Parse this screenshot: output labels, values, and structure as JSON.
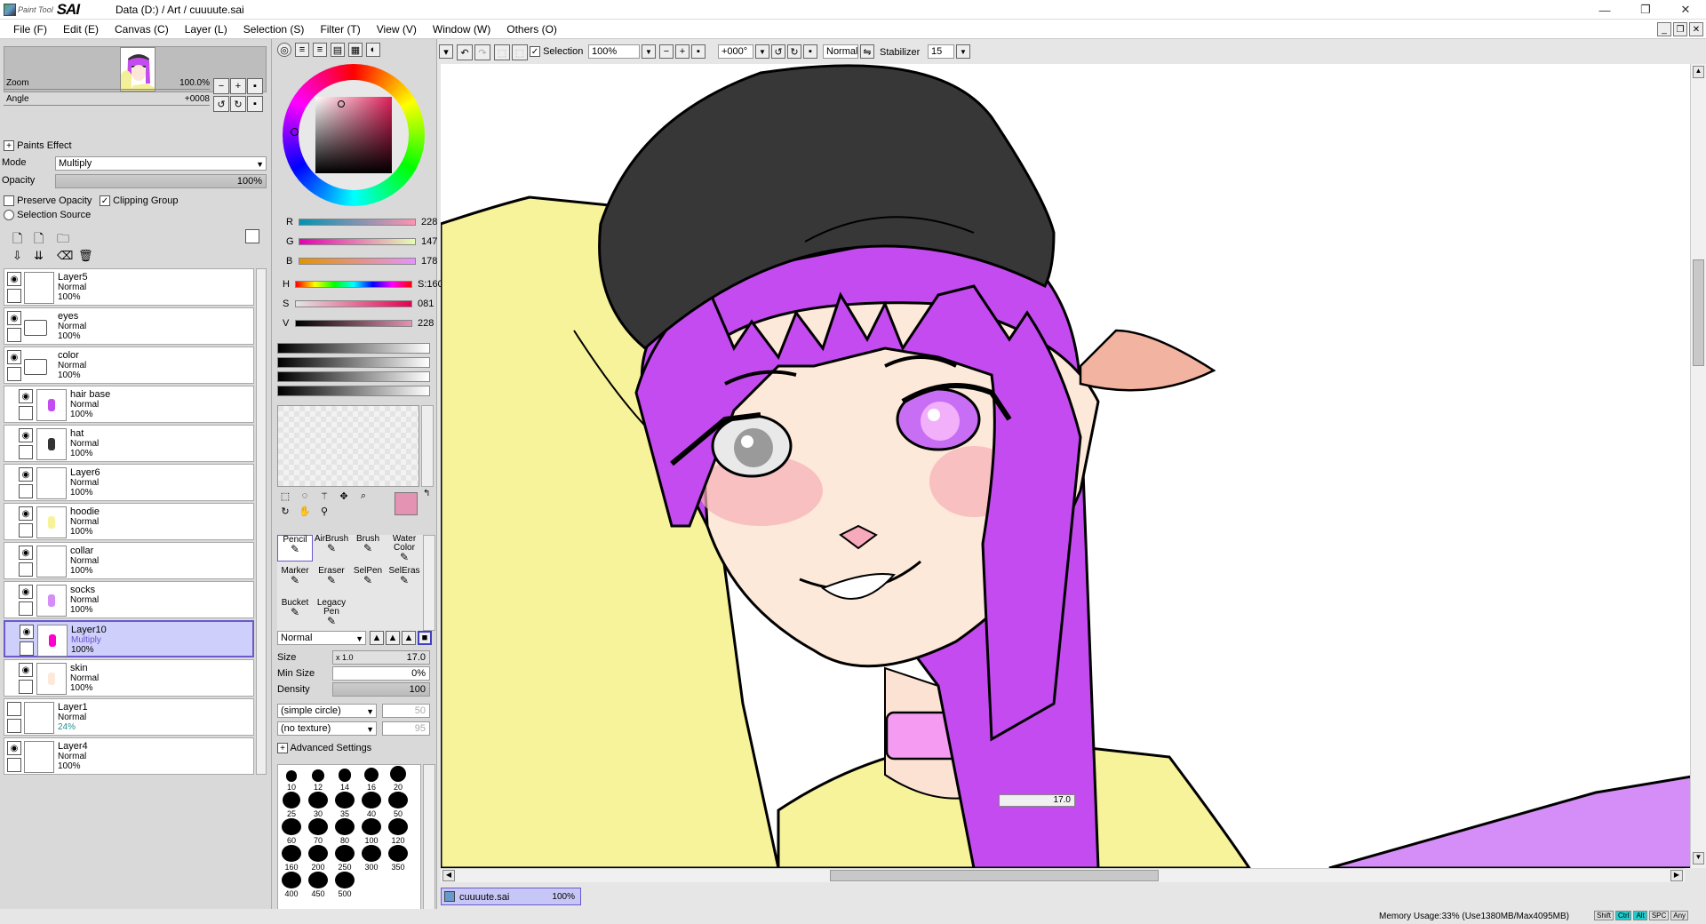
{
  "window": {
    "app_name_small": "Paint Tool",
    "app_name_big": "SAI",
    "title": "Data (D:) / Art / cuuuute.sai",
    "controls": {
      "minimize": "—",
      "restore": "❐",
      "close": "✕"
    }
  },
  "menu": [
    {
      "label": "File (F)"
    },
    {
      "label": "Edit (E)"
    },
    {
      "label": "Canvas (C)"
    },
    {
      "label": "Layer (L)"
    },
    {
      "label": "Selection (S)"
    },
    {
      "label": "Filter (T)"
    },
    {
      "label": "View (V)"
    },
    {
      "label": "Window (W)"
    },
    {
      "label": "Others (O)"
    }
  ],
  "navigator": {
    "zoom_label": "Zoom",
    "zoom_value": "100.0%",
    "angle_label": "Angle",
    "angle_value": "+0008"
  },
  "layer_props": {
    "paints_effect": "Paints Effect",
    "mode_label": "Mode",
    "mode_value": "Multiply",
    "opacity_label": "Opacity",
    "opacity_value": "100%",
    "preserve_opacity": "Preserve Opacity",
    "clipping_group": "Clipping Group",
    "selection_source": "Selection Source"
  },
  "layers": [
    {
      "name": "Layer5",
      "mode": "Normal",
      "opacity": "100%",
      "visible": true,
      "folder": false,
      "indent": false,
      "selected": false
    },
    {
      "name": "eyes",
      "mode": "Normal",
      "opacity": "100%",
      "visible": true,
      "folder": true,
      "indent": false,
      "selected": false
    },
    {
      "name": "color",
      "mode": "Normal",
      "opacity": "100%",
      "visible": true,
      "folder": true,
      "indent": false,
      "selected": false
    },
    {
      "name": "hair base",
      "mode": "Normal",
      "opacity": "100%",
      "visible": true,
      "folder": false,
      "indent": true,
      "selected": false
    },
    {
      "name": "hat",
      "mode": "Normal",
      "opacity": "100%",
      "visible": true,
      "folder": false,
      "indent": true,
      "selected": false
    },
    {
      "name": "Layer6",
      "mode": "Normal",
      "opacity": "100%",
      "visible": true,
      "folder": false,
      "indent": true,
      "selected": false
    },
    {
      "name": "hoodie",
      "mode": "Normal",
      "opacity": "100%",
      "visible": true,
      "folder": false,
      "indent": true,
      "selected": false
    },
    {
      "name": "collar",
      "mode": "Normal",
      "opacity": "100%",
      "visible": true,
      "folder": false,
      "indent": true,
      "selected": false
    },
    {
      "name": "socks",
      "mode": "Normal",
      "opacity": "100%",
      "visible": true,
      "folder": false,
      "indent": true,
      "selected": false
    },
    {
      "name": "Layer10",
      "mode": "Multiply",
      "opacity": "100%",
      "visible": true,
      "folder": false,
      "indent": true,
      "selected": true
    },
    {
      "name": "skin",
      "mode": "Normal",
      "opacity": "100%",
      "visible": true,
      "folder": false,
      "indent": true,
      "selected": false
    },
    {
      "name": "Layer1",
      "mode": "Normal",
      "opacity": "24%",
      "visible": false,
      "folder": false,
      "indent": false,
      "selected": false
    },
    {
      "name": "Layer4",
      "mode": "Normal",
      "opacity": "100%",
      "visible": true,
      "folder": false,
      "indent": false,
      "selected": false
    }
  ],
  "color": {
    "r_label": "R",
    "r": "228",
    "g_label": "G",
    "g": "147",
    "b_label": "B",
    "b": "178",
    "h_label": "H",
    "h": "S:160",
    "s_label": "S",
    "s": "081",
    "v_label": "V",
    "v": "228",
    "primary": "#e493b2"
  },
  "tools": [
    {
      "label": "Pencil",
      "selected": true
    },
    {
      "label": "AirBrush",
      "selected": false
    },
    {
      "label": "Brush",
      "selected": false
    },
    {
      "label": "Water Color",
      "selected": false
    },
    {
      "label": "Marker",
      "selected": false
    },
    {
      "label": "Eraser",
      "selected": false
    },
    {
      "label": "SelPen",
      "selected": false
    },
    {
      "label": "SelEras",
      "selected": false
    },
    {
      "label": "Bucket",
      "selected": false
    },
    {
      "label": "Legacy Pen",
      "selected": false
    }
  ],
  "brush": {
    "blend_mode": "Normal",
    "size_label": "Size",
    "size_mult": "x 1.0",
    "size_value": "17.0",
    "min_size_label": "Min Size",
    "min_size_value": "0%",
    "density_label": "Density",
    "density_value": "100",
    "shape": "(simple circle)",
    "shape_value": "50",
    "texture": "(no texture)",
    "texture_value": "95",
    "advanced": "Advanced Settings",
    "sizes": [
      "10",
      "12",
      "14",
      "16",
      "20",
      "25",
      "30",
      "35",
      "40",
      "50",
      "60",
      "70",
      "80",
      "100",
      "120",
      "160",
      "200",
      "250",
      "300",
      "350",
      "400",
      "450",
      "500"
    ]
  },
  "toolbar": {
    "selection_label": "Selection",
    "zoom": "100%",
    "angle": "+000°",
    "mode": "Normal",
    "stabilizer_label": "Stabilizer",
    "stabilizer": "15"
  },
  "canvas": {
    "size_tooltip": "17.0"
  },
  "docs": [
    {
      "name": "cuuuute.sai",
      "zoom": "100%"
    }
  ],
  "status": {
    "memory": "Memory Usage:33% (Use1380MB/Max4095MB)",
    "keys": [
      "Shift",
      "Ctrl",
      "Alt",
      "SPC",
      "Any"
    ]
  }
}
